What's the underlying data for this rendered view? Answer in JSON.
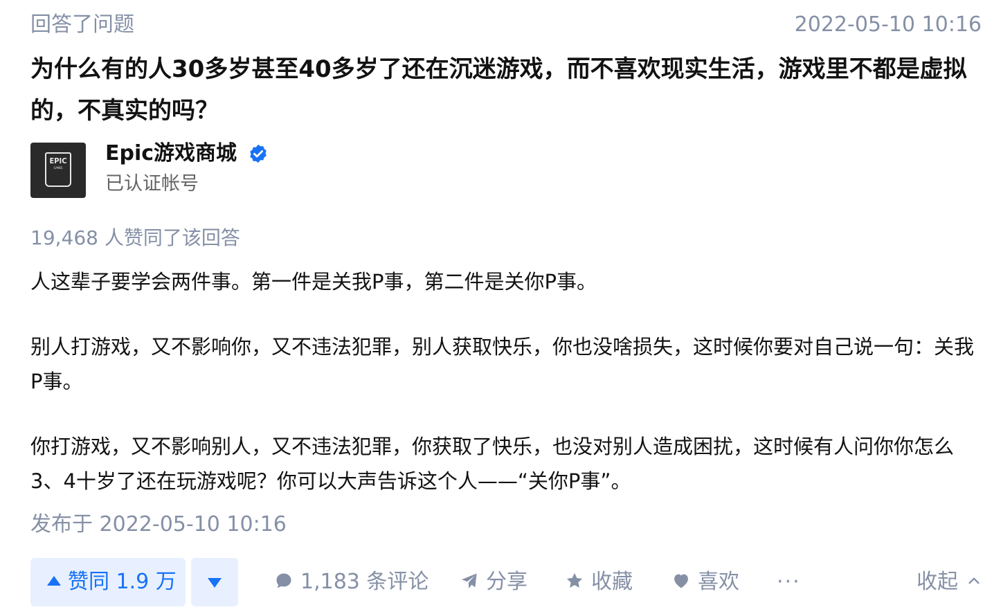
{
  "header": {
    "action_type": "回答了问题",
    "time": "2022-05-10 10:16"
  },
  "question": {
    "title": "为什么有的人30多岁甚至40多岁了还在沉迷游戏，而不喜欢现实生活，游戏里不都是虚拟的，不真实的吗？"
  },
  "author": {
    "name": "Epic游戏商城",
    "badge": "已认证帐号",
    "avatar_icon": "epic-games-store-logo",
    "avatar_text": "EPIC",
    "avatar_subtext": "GAMES",
    "verified": true
  },
  "answer": {
    "vote_summary": "19,468 人赞同了该回答",
    "paragraphs": [
      "人这辈子要学会两件事。第一件是关我P事，第二件是关你P事。",
      "别人打游戏，又不影响你，又不违法犯罪，别人获取快乐，你也没啥损失，这时候你要对自己说一句：关我P事。",
      "你打游戏，又不影响别人，又不违法犯罪，你获取了快乐，也没对别人造成困扰，这时候有人问你你怎么3、4十岁了还在玩游戏呢？你可以大声告诉这个人——“关你P事”。"
    ],
    "publish_time": "发布于 2022-05-10 10:16"
  },
  "actions": {
    "vote_up_label": "赞同 1.9 万",
    "comments_label": "1,183 条评论",
    "share_label": "分享",
    "collect_label": "收藏",
    "like_label": "喜欢",
    "more_label": "···",
    "collapse_label": "收起"
  },
  "colors": {
    "accent": "#1772f6",
    "vote_bg": "#e8f0ff",
    "meta": "#8590a6",
    "text": "#121212"
  }
}
